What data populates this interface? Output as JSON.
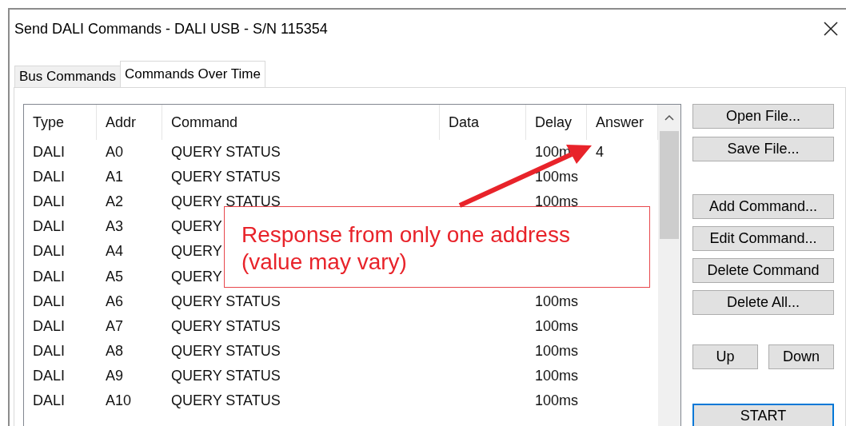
{
  "window": {
    "title": "Send DALI Commands - DALI USB - S/N 115354"
  },
  "tabs": [
    {
      "label": "Bus Commands",
      "selected": false
    },
    {
      "label": "Commands Over Time",
      "selected": true
    }
  ],
  "table": {
    "columns": [
      "Type",
      "Addr",
      "Command",
      "Data",
      "Delay",
      "Answer"
    ],
    "rows": [
      {
        "type": "DALI",
        "addr": "A0",
        "command": "QUERY STATUS",
        "delay": "100m",
        "answer": "4"
      },
      {
        "type": "DALI",
        "addr": "A1",
        "command": "QUERY STATUS",
        "delay": "100ms"
      },
      {
        "type": "DALI",
        "addr": "A2",
        "command": "QUERY STATUS",
        "delay": "100ms"
      },
      {
        "type": "DALI",
        "addr": "A3",
        "command": "QUERY"
      },
      {
        "type": "DALI",
        "addr": "A4",
        "command": "QUERY"
      },
      {
        "type": "DALI",
        "addr": "A5",
        "command": "QUERY"
      },
      {
        "type": "DALI",
        "addr": "A6",
        "command": "QUERY STATUS",
        "delay": "100ms"
      },
      {
        "type": "DALI",
        "addr": "A7",
        "command": "QUERY STATUS",
        "delay": "100ms"
      },
      {
        "type": "DALI",
        "addr": "A8",
        "command": "QUERY STATUS",
        "delay": "100ms"
      },
      {
        "type": "DALI",
        "addr": "A9",
        "command": "QUERY STATUS",
        "delay": "100ms"
      },
      {
        "type": "DALI",
        "addr": "A10",
        "command": "QUERY STATUS",
        "delay": "100ms"
      }
    ]
  },
  "buttons": [
    {
      "label": "Open File...",
      "default": false
    },
    {
      "label": "Save File...",
      "default": false
    },
    {
      "label": "Add Command...",
      "default": false
    },
    {
      "label": "Edit Command...",
      "default": false
    },
    {
      "label": "Delete Command",
      "default": false
    },
    {
      "label": "Delete All...",
      "default": false
    },
    {
      "label": "Up",
      "default": false
    },
    {
      "label": "Down",
      "default": false
    },
    {
      "label": "START",
      "default": true
    }
  ],
  "callout": {
    "lines": [
      "Response from only one address",
      "(value may vary)"
    ]
  }
}
